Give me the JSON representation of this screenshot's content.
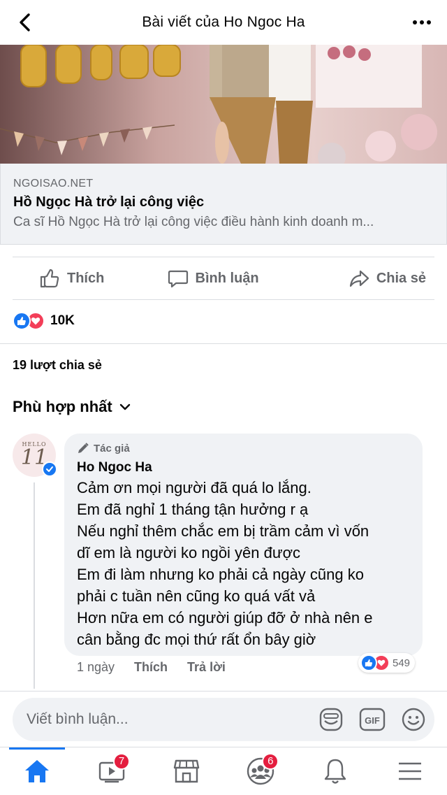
{
  "header": {
    "title": "Bài viết của Ho Ngoc Ha",
    "back_icon": "chevron-left-icon",
    "more_icon": "more-horizontal-icon"
  },
  "post": {
    "image_alt": "",
    "link": {
      "source": "NGOISAO.NET",
      "title": "Hồ Ngọc Hà trở lại công việc",
      "description": "Ca sĩ Hồ Ngọc Hà trở lại công việc điều hành kinh doanh m..."
    },
    "actions": {
      "like": "Thích",
      "comment": "Bình luận",
      "share": "Chia sẻ"
    },
    "reactions_count": "10K",
    "shares_text": "19 lượt chia sẻ",
    "sort_label": "Phù hợp nhất"
  },
  "comment": {
    "author_tag": "Tác giả",
    "author_name": "Ho Ngoc Ha",
    "avatar_text": {
      "hello": "HELLO",
      "num": "11"
    },
    "lines": [
      "Cảm ơn mọi người đã quá lo lắng.",
      "Em đã nghỉ 1 tháng tận hưởng r ạ",
      "Nếu nghỉ thêm chắc em bị trầm cảm vì vốn",
      "dĩ em là người ko ngồi yên được",
      "Em đi làm nhưng ko phải cả ngày cũng ko",
      "phải c tuần nên cũng ko quá vất vả",
      "Hơn nữa em có người giúp đỡ ở nhà nên e",
      "cân bằng đc mọi thứ rất ổn bây giờ"
    ],
    "time": "1 ngày",
    "like": "Thích",
    "reply": "Trả lời",
    "reaction_count": "549"
  },
  "composer": {
    "placeholder": "Viết bình luận...",
    "gif_label": "GIF"
  },
  "tabbar": {
    "video_badge": "7",
    "groups_badge": "6"
  },
  "colors": {
    "accent": "#1877f2",
    "love": "#f33e58",
    "badge": "#e41e3f",
    "secondary_text": "#65676b",
    "bubble": "#f0f2f5"
  }
}
